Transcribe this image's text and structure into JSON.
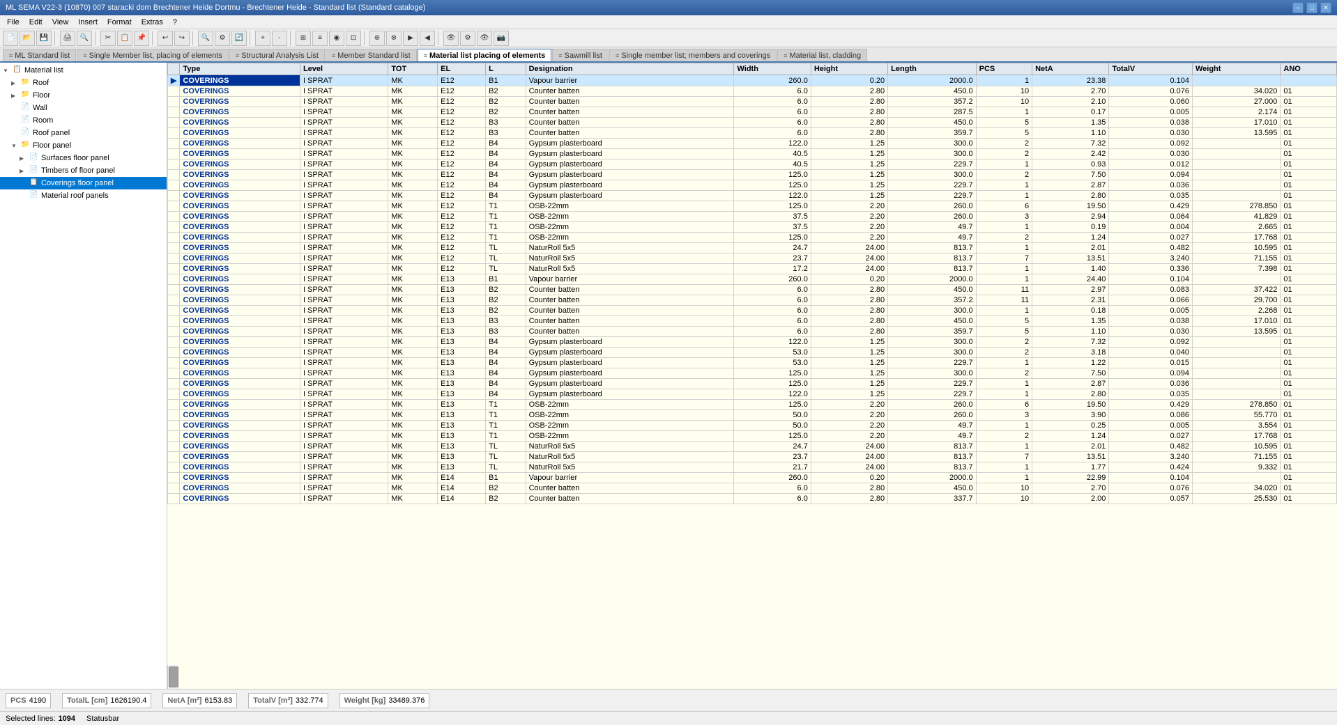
{
  "window": {
    "title": "ML SEMA V22-3 (10870) 007 staracki dom Brechtener Heide Dortmu - Brechtener Heide - Standard list (Standard cataloge)"
  },
  "menu": {
    "items": [
      "File",
      "Edit",
      "View",
      "Insert",
      "Format",
      "Extras",
      "?"
    ]
  },
  "tabs": [
    {
      "id": "ml-standard",
      "label": "ML Standard list",
      "icon": "≡",
      "active": false
    },
    {
      "id": "single-member-placing",
      "label": "Single Member list, placing of elements",
      "icon": "≡",
      "active": false
    },
    {
      "id": "structural",
      "label": "Structural Analysis List",
      "icon": "≡",
      "active": false
    },
    {
      "id": "member-standard",
      "label": "Member Standard list",
      "icon": "≡",
      "active": false
    },
    {
      "id": "material-placing",
      "label": "Material list placing of elements",
      "icon": "≡",
      "active": true
    },
    {
      "id": "sawmill",
      "label": "Sawmill list",
      "icon": "≡",
      "active": false
    },
    {
      "id": "single-member-coverings",
      "label": "Single member list; members and coverings",
      "icon": "≡",
      "active": false
    },
    {
      "id": "material-cladding",
      "label": "Material list, cladding",
      "icon": "≡",
      "active": false
    }
  ],
  "tree": {
    "title": "Material list",
    "items": [
      {
        "id": "material-list",
        "label": "Material list",
        "indent": 0,
        "arrow": "▼",
        "icon": "📋",
        "selected": false
      },
      {
        "id": "roof",
        "label": "Roof",
        "indent": 1,
        "arrow": "▶",
        "icon": "📁",
        "selected": false
      },
      {
        "id": "floor",
        "label": "Floor",
        "indent": 1,
        "arrow": "▶",
        "icon": "📁",
        "selected": false
      },
      {
        "id": "wall",
        "label": "Wall",
        "indent": 1,
        "arrow": "",
        "icon": "📄",
        "selected": false
      },
      {
        "id": "room",
        "label": "Room",
        "indent": 1,
        "arrow": "",
        "icon": "📄",
        "selected": false
      },
      {
        "id": "roof-panel",
        "label": "Roof panel",
        "indent": 1,
        "arrow": "",
        "icon": "📄",
        "selected": false
      },
      {
        "id": "floor-panel",
        "label": "Floor panel",
        "indent": 1,
        "arrow": "▼",
        "icon": "📁",
        "selected": false
      },
      {
        "id": "surfaces-floor-panel",
        "label": "Surfaces floor panel",
        "indent": 2,
        "arrow": "▶",
        "icon": "📄",
        "selected": false
      },
      {
        "id": "timbers-floor-panel",
        "label": "Timbers of floor panel",
        "indent": 2,
        "arrow": "▶",
        "icon": "📄",
        "selected": false
      },
      {
        "id": "coverings-floor-panel",
        "label": "Coverings floor panel",
        "indent": 2,
        "arrow": "",
        "icon": "📋",
        "selected": true
      },
      {
        "id": "material-roof-panels",
        "label": "Material roof panels",
        "indent": 2,
        "arrow": "",
        "icon": "📄",
        "selected": false
      }
    ]
  },
  "table": {
    "columns": [
      "",
      "Type",
      "Level",
      "TOT",
      "EL",
      "L",
      "Designation",
      "Width",
      "Height",
      "Length",
      "PCS",
      "NetA",
      "TotalV",
      "Weight",
      "ANO"
    ],
    "rows": [
      [
        "▶",
        "COVERINGS",
        "I SPRAT",
        "MK",
        "E12",
        "B1",
        "Vapour barrier",
        "260.0",
        "0.20",
        "2000.0",
        "1",
        "23.38",
        "0.104",
        "",
        ""
      ],
      [
        "",
        "COVERINGS",
        "I SPRAT",
        "MK",
        "E12",
        "B2",
        "Counter batten",
        "6.0",
        "2.80",
        "450.0",
        "10",
        "2.70",
        "0.076",
        "34.020",
        "01"
      ],
      [
        "",
        "COVERINGS",
        "I SPRAT",
        "MK",
        "E12",
        "B2",
        "Counter batten",
        "6.0",
        "2.80",
        "357.2",
        "10",
        "2.10",
        "0.060",
        "27.000",
        "01"
      ],
      [
        "",
        "COVERINGS",
        "I SPRAT",
        "MK",
        "E12",
        "B2",
        "Counter batten",
        "6.0",
        "2.80",
        "287.5",
        "1",
        "0.17",
        "0.005",
        "2.174",
        "01"
      ],
      [
        "",
        "COVERINGS",
        "I SPRAT",
        "MK",
        "E12",
        "B3",
        "Counter batten",
        "6.0",
        "2.80",
        "450.0",
        "5",
        "1.35",
        "0.038",
        "17.010",
        "01"
      ],
      [
        "",
        "COVERINGS",
        "I SPRAT",
        "MK",
        "E12",
        "B3",
        "Counter batten",
        "6.0",
        "2.80",
        "359.7",
        "5",
        "1.10",
        "0.030",
        "13.595",
        "01"
      ],
      [
        "",
        "COVERINGS",
        "I SPRAT",
        "MK",
        "E12",
        "B4",
        "Gypsum plasterboard",
        "122.0",
        "1.25",
        "300.0",
        "2",
        "7.32",
        "0.092",
        "",
        "01"
      ],
      [
        "",
        "COVERINGS",
        "I SPRAT",
        "MK",
        "E12",
        "B4",
        "Gypsum plasterboard",
        "40.5",
        "1.25",
        "300.0",
        "2",
        "2.42",
        "0.030",
        "",
        "01"
      ],
      [
        "",
        "COVERINGS",
        "I SPRAT",
        "MK",
        "E12",
        "B4",
        "Gypsum plasterboard",
        "40.5",
        "1.25",
        "229.7",
        "1",
        "0.93",
        "0.012",
        "",
        "01"
      ],
      [
        "",
        "COVERINGS",
        "I SPRAT",
        "MK",
        "E12",
        "B4",
        "Gypsum plasterboard",
        "125.0",
        "1.25",
        "300.0",
        "2",
        "7.50",
        "0.094",
        "",
        "01"
      ],
      [
        "",
        "COVERINGS",
        "I SPRAT",
        "MK",
        "E12",
        "B4",
        "Gypsum plasterboard",
        "125.0",
        "1.25",
        "229.7",
        "1",
        "2.87",
        "0.036",
        "",
        "01"
      ],
      [
        "",
        "COVERINGS",
        "I SPRAT",
        "MK",
        "E12",
        "B4",
        "Gypsum plasterboard",
        "122.0",
        "1.25",
        "229.7",
        "1",
        "2.80",
        "0.035",
        "",
        "01"
      ],
      [
        "",
        "COVERINGS",
        "I SPRAT",
        "MK",
        "E12",
        "T1",
        "OSB-22mm",
        "125.0",
        "2.20",
        "260.0",
        "6",
        "19.50",
        "0.429",
        "278.850",
        "01"
      ],
      [
        "",
        "COVERINGS",
        "I SPRAT",
        "MK",
        "E12",
        "T1",
        "OSB-22mm",
        "37.5",
        "2.20",
        "260.0",
        "3",
        "2.94",
        "0.064",
        "41.829",
        "01"
      ],
      [
        "",
        "COVERINGS",
        "I SPRAT",
        "MK",
        "E12",
        "T1",
        "OSB-22mm",
        "37.5",
        "2.20",
        "49.7",
        "1",
        "0.19",
        "0.004",
        "2.665",
        "01"
      ],
      [
        "",
        "COVERINGS",
        "I SPRAT",
        "MK",
        "E12",
        "T1",
        "OSB-22mm",
        "125.0",
        "2.20",
        "49.7",
        "2",
        "1.24",
        "0.027",
        "17.768",
        "01"
      ],
      [
        "",
        "COVERINGS",
        "I SPRAT",
        "MK",
        "E12",
        "TL",
        "NaturRoll 5x5",
        "24.7",
        "24.00",
        "813.7",
        "1",
        "2.01",
        "0.482",
        "10.595",
        "01"
      ],
      [
        "",
        "COVERINGS",
        "I SPRAT",
        "MK",
        "E12",
        "TL",
        "NaturRoll 5x5",
        "23.7",
        "24.00",
        "813.7",
        "7",
        "13.51",
        "3.240",
        "71.155",
        "01"
      ],
      [
        "",
        "COVERINGS",
        "I SPRAT",
        "MK",
        "E12",
        "TL",
        "NaturRoll 5x5",
        "17.2",
        "24.00",
        "813.7",
        "1",
        "1.40",
        "0.336",
        "7.398",
        "01"
      ],
      [
        "",
        "COVERINGS",
        "I SPRAT",
        "MK",
        "E13",
        "B1",
        "Vapour barrier",
        "260.0",
        "0.20",
        "2000.0",
        "1",
        "24.40",
        "0.104",
        "",
        "01"
      ],
      [
        "",
        "COVERINGS",
        "I SPRAT",
        "MK",
        "E13",
        "B2",
        "Counter batten",
        "6.0",
        "2.80",
        "450.0",
        "11",
        "2.97",
        "0.083",
        "37.422",
        "01"
      ],
      [
        "",
        "COVERINGS",
        "I SPRAT",
        "MK",
        "E13",
        "B2",
        "Counter batten",
        "6.0",
        "2.80",
        "357.2",
        "11",
        "2.31",
        "0.066",
        "29.700",
        "01"
      ],
      [
        "",
        "COVERINGS",
        "I SPRAT",
        "MK",
        "E13",
        "B2",
        "Counter batten",
        "6.0",
        "2.80",
        "300.0",
        "1",
        "0.18",
        "0.005",
        "2.268",
        "01"
      ],
      [
        "",
        "COVERINGS",
        "I SPRAT",
        "MK",
        "E13",
        "B3",
        "Counter batten",
        "6.0",
        "2.80",
        "450.0",
        "5",
        "1.35",
        "0.038",
        "17.010",
        "01"
      ],
      [
        "",
        "COVERINGS",
        "I SPRAT",
        "MK",
        "E13",
        "B3",
        "Counter batten",
        "6.0",
        "2.80",
        "359.7",
        "5",
        "1.10",
        "0.030",
        "13.595",
        "01"
      ],
      [
        "",
        "COVERINGS",
        "I SPRAT",
        "MK",
        "E13",
        "B4",
        "Gypsum plasterboard",
        "122.0",
        "1.25",
        "300.0",
        "2",
        "7.32",
        "0.092",
        "",
        "01"
      ],
      [
        "",
        "COVERINGS",
        "I SPRAT",
        "MK",
        "E13",
        "B4",
        "Gypsum plasterboard",
        "53.0",
        "1.25",
        "300.0",
        "2",
        "3.18",
        "0.040",
        "",
        "01"
      ],
      [
        "",
        "COVERINGS",
        "I SPRAT",
        "MK",
        "E13",
        "B4",
        "Gypsum plasterboard",
        "53.0",
        "1.25",
        "229.7",
        "1",
        "1.22",
        "0.015",
        "",
        "01"
      ],
      [
        "",
        "COVERINGS",
        "I SPRAT",
        "MK",
        "E13",
        "B4",
        "Gypsum plasterboard",
        "125.0",
        "1.25",
        "300.0",
        "2",
        "7.50",
        "0.094",
        "",
        "01"
      ],
      [
        "",
        "COVERINGS",
        "I SPRAT",
        "MK",
        "E13",
        "B4",
        "Gypsum plasterboard",
        "125.0",
        "1.25",
        "229.7",
        "1",
        "2.87",
        "0.036",
        "",
        "01"
      ],
      [
        "",
        "COVERINGS",
        "I SPRAT",
        "MK",
        "E13",
        "B4",
        "Gypsum plasterboard",
        "122.0",
        "1.25",
        "229.7",
        "1",
        "2.80",
        "0.035",
        "",
        "01"
      ],
      [
        "",
        "COVERINGS",
        "I SPRAT",
        "MK",
        "E13",
        "T1",
        "OSB-22mm",
        "125.0",
        "2.20",
        "260.0",
        "6",
        "19.50",
        "0.429",
        "278.850",
        "01"
      ],
      [
        "",
        "COVERINGS",
        "I SPRAT",
        "MK",
        "E13",
        "T1",
        "OSB-22mm",
        "50.0",
        "2.20",
        "260.0",
        "3",
        "3.90",
        "0.086",
        "55.770",
        "01"
      ],
      [
        "",
        "COVERINGS",
        "I SPRAT",
        "MK",
        "E13",
        "T1",
        "OSB-22mm",
        "50.0",
        "2.20",
        "49.7",
        "1",
        "0.25",
        "0.005",
        "3.554",
        "01"
      ],
      [
        "",
        "COVERINGS",
        "I SPRAT",
        "MK",
        "E13",
        "T1",
        "OSB-22mm",
        "125.0",
        "2.20",
        "49.7",
        "2",
        "1.24",
        "0.027",
        "17.768",
        "01"
      ],
      [
        "",
        "COVERINGS",
        "I SPRAT",
        "MK",
        "E13",
        "TL",
        "NaturRoll 5x5",
        "24.7",
        "24.00",
        "813.7",
        "1",
        "2.01",
        "0.482",
        "10.595",
        "01"
      ],
      [
        "",
        "COVERINGS",
        "I SPRAT",
        "MK",
        "E13",
        "TL",
        "NaturRoll 5x5",
        "23.7",
        "24.00",
        "813.7",
        "7",
        "13.51",
        "3.240",
        "71.155",
        "01"
      ],
      [
        "",
        "COVERINGS",
        "I SPRAT",
        "MK",
        "E13",
        "TL",
        "NaturRoll 5x5",
        "21.7",
        "24.00",
        "813.7",
        "1",
        "1.77",
        "0.424",
        "9.332",
        "01"
      ],
      [
        "",
        "COVERINGS",
        "I SPRAT",
        "MK",
        "E14",
        "B1",
        "Vapour barrier",
        "260.0",
        "0.20",
        "2000.0",
        "1",
        "22.99",
        "0.104",
        "",
        "01"
      ],
      [
        "",
        "COVERINGS",
        "I SPRAT",
        "MK",
        "E14",
        "B2",
        "Counter batten",
        "6.0",
        "2.80",
        "450.0",
        "10",
        "2.70",
        "0.076",
        "34.020",
        "01"
      ],
      [
        "",
        "COVERINGS",
        "I SPRAT",
        "MK",
        "E14",
        "B2",
        "Counter batten",
        "6.0",
        "2.80",
        "337.7",
        "10",
        "2.00",
        "0.057",
        "25.530",
        "01"
      ]
    ]
  },
  "status": {
    "pcs_label": "PCS",
    "pcs_value": "4190",
    "total_l_label": "TotalL [cm]",
    "total_l_value": "1626190.4",
    "net_a_label": "NetA [m²]",
    "net_a_value": "6153.83",
    "total_v_label": "TotalV [m³]",
    "total_v_value": "332.774",
    "weight_label": "Weight [kg]",
    "weight_value": "33489.376",
    "selected_label": "Selected lines:",
    "selected_value": "1094",
    "statusbar_label": "Statusbar"
  }
}
